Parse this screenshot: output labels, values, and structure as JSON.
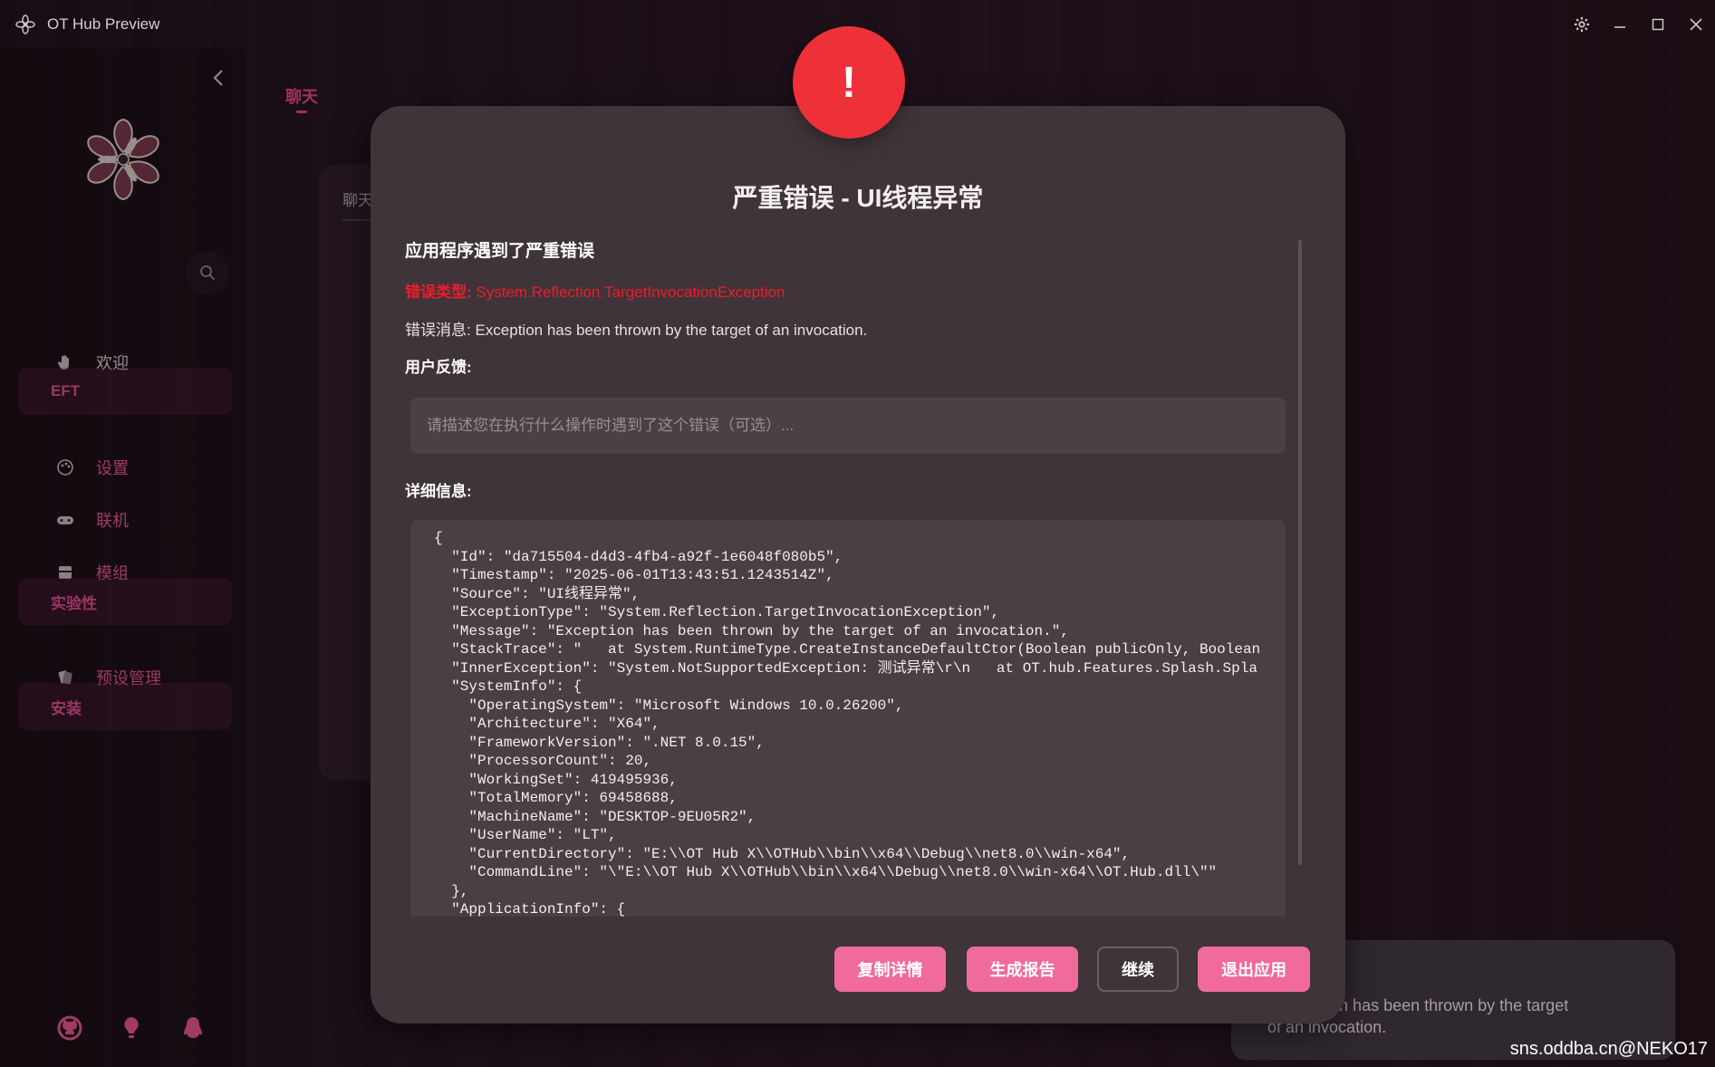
{
  "window": {
    "title": "OT Hub Preview"
  },
  "sidebar": {
    "items": [
      {
        "label": "欢迎",
        "icon": "hand-icon"
      },
      {
        "label": "设置",
        "icon": "palette-icon"
      },
      {
        "label": "联机",
        "icon": "gamepad-icon"
      },
      {
        "label": "模组",
        "icon": "archive-icon"
      },
      {
        "label": "预设管理",
        "icon": "cards-icon"
      }
    ],
    "groups": [
      "EFT",
      "实验性",
      "安装"
    ]
  },
  "main": {
    "tab_chat": "聊天",
    "panel_label": "聊天"
  },
  "dialog": {
    "badge": "!",
    "title": "严重错误 - UI线程异常",
    "subtitle": "应用程序遇到了严重错误",
    "error_type_label": "错误类型:",
    "error_type_value": " System.Reflection.TargetInvocationException",
    "error_message_label": "错误消息:",
    "error_message_value": " Exception has been thrown by the target of an invocation.",
    "feedback_label": "用户反馈:",
    "feedback_placeholder": "请描述您在执行什么操作时遇到了这个错误（可选）...",
    "details_label": "详细信息:",
    "details_json": "{\n  \"Id\": \"da715504-d4d3-4fb4-a92f-1e6048f080b5\",\n  \"Timestamp\": \"2025-06-01T13:43:51.1243514Z\",\n  \"Source\": \"UI线程异常\",\n  \"ExceptionType\": \"System.Reflection.TargetInvocationException\",\n  \"Message\": \"Exception has been thrown by the target of an invocation.\",\n  \"StackTrace\": \"   at System.RuntimeType.CreateInstanceDefaultCtor(Boolean publicOnly, Boolean\n  \"InnerException\": \"System.NotSupportedException: 测试异常\\r\\n   at OT.hub.Features.Splash.Spla\n  \"SystemInfo\": {\n    \"OperatingSystem\": \"Microsoft Windows 10.0.26200\",\n    \"Architecture\": \"X64\",\n    \"FrameworkVersion\": \".NET 8.0.15\",\n    \"ProcessorCount\": 20,\n    \"WorkingSet\": 419495936,\n    \"TotalMemory\": 69458688,\n    \"MachineName\": \"DESKTOP-9EU05R2\",\n    \"UserName\": \"LT\",\n    \"CurrentDirectory\": \"E:\\\\OT Hub X\\\\OTHub\\\\bin\\\\x64\\\\Debug\\\\net8.0\\\\win-x64\",\n    \"CommandLine\": \"\\\"E:\\\\OT Hub X\\\\OTHub\\\\bin\\\\x64\\\\Debug\\\\net8.0\\\\win-x64\\\\OT.Hub.dll\\\"\"\n  },\n  \"ApplicationInfo\": {",
    "buttons": {
      "copy": "复制详情",
      "report": "生成报告",
      "continue": "继续",
      "exit": "退出应用"
    }
  },
  "toast": {
    "text_line1": ": Exception has been thrown by the target",
    "text_line2": "of an invocation."
  },
  "watermark": "sns.oddba.cn@NEKO17",
  "colors": {
    "accent": "#f06a9c",
    "error": "#ee3039",
    "dialog_bg": "#3f3439"
  }
}
